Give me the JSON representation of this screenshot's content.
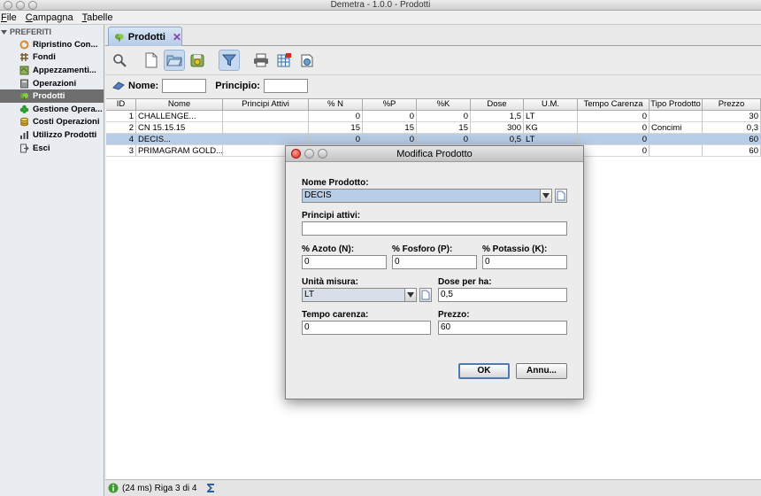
{
  "window": {
    "title": "Demetra - 1.0.0 - Prodotti"
  },
  "menu": [
    "File",
    "Campagna",
    "Tabelle"
  ],
  "sidebar": {
    "heading": "PREFERITI",
    "items": [
      {
        "label": "Ripristino Con...",
        "icon": "recycle-icon",
        "color": "#d98b2b"
      },
      {
        "label": "Fondi",
        "icon": "grid-icon",
        "color": "#7a5a2b"
      },
      {
        "label": "Appezzamenti...",
        "icon": "map-icon",
        "color": "#6d8b3a"
      },
      {
        "label": "Operazioni",
        "icon": "book-icon",
        "color": "#7a7a7a"
      },
      {
        "label": "Prodotti",
        "icon": "plant-icon",
        "color": "#6aa832",
        "active": true
      },
      {
        "label": "Gestione Opera...",
        "icon": "clover-icon",
        "color": "#2e9b2e"
      },
      {
        "label": "Costi Operazioni",
        "icon": "coins-icon",
        "color": "#c9a227"
      },
      {
        "label": "Utilizzo Prodotti",
        "icon": "chart-icon",
        "color": "#444444"
      },
      {
        "label": "Esci",
        "icon": "exit-icon",
        "color": "#555555"
      }
    ]
  },
  "tab": {
    "label": "Prodotti"
  },
  "filters": {
    "nome_label": "Nome:",
    "principio_label": "Principio:",
    "nome_value": "",
    "principio_value": ""
  },
  "table": {
    "columns": [
      "ID",
      "Nome",
      "Principi Attivi",
      "% N",
      "%P",
      "%K",
      "Dose",
      "U.M.",
      "Tempo Carenza",
      "Tipo Prodotto",
      "Prezzo"
    ],
    "rows": [
      [
        "1",
        "CHALLENGE...",
        "",
        "0",
        "0",
        "0",
        "1,5",
        "LT",
        "0",
        "",
        "30"
      ],
      [
        "2",
        "CN 15.15.15",
        "",
        "15",
        "15",
        "15",
        "300",
        "KG",
        "0",
        "Concimi",
        "0,3"
      ],
      [
        "4",
        "DECIS...",
        "",
        "0",
        "0",
        "0",
        "0,5",
        "LT",
        "0",
        "",
        "60"
      ],
      [
        "3",
        "PRIMAGRAM GOLD...",
        "",
        "",
        "",
        "",
        "",
        "",
        "0",
        "",
        "60"
      ]
    ],
    "selected_row": 2
  },
  "status": {
    "text": "(24 ms) Riga 3 di 4"
  },
  "dialog": {
    "title": "Modifica Prodotto",
    "nome_label": "Nome Prodotto:",
    "nome_value": "DECIS",
    "principi_label": "Principi attivi:",
    "principi_value": "",
    "azoto_label": "% Azoto (N):",
    "azoto_value": "0",
    "fosforo_label": "% Fosforo (P):",
    "fosforo_value": "0",
    "potassio_label": "% Potassio (K):",
    "potassio_value": "0",
    "unita_label": "Unità misura:",
    "unita_value": "LT",
    "dose_label": "Dose per ha:",
    "dose_value": "0,5",
    "carenza_label": "Tempo carenza:",
    "carenza_value": "0",
    "prezzo_label": "Prezzo:",
    "prezzo_value": "60",
    "ok_label": "OK",
    "annulla_label": "Annu..."
  }
}
